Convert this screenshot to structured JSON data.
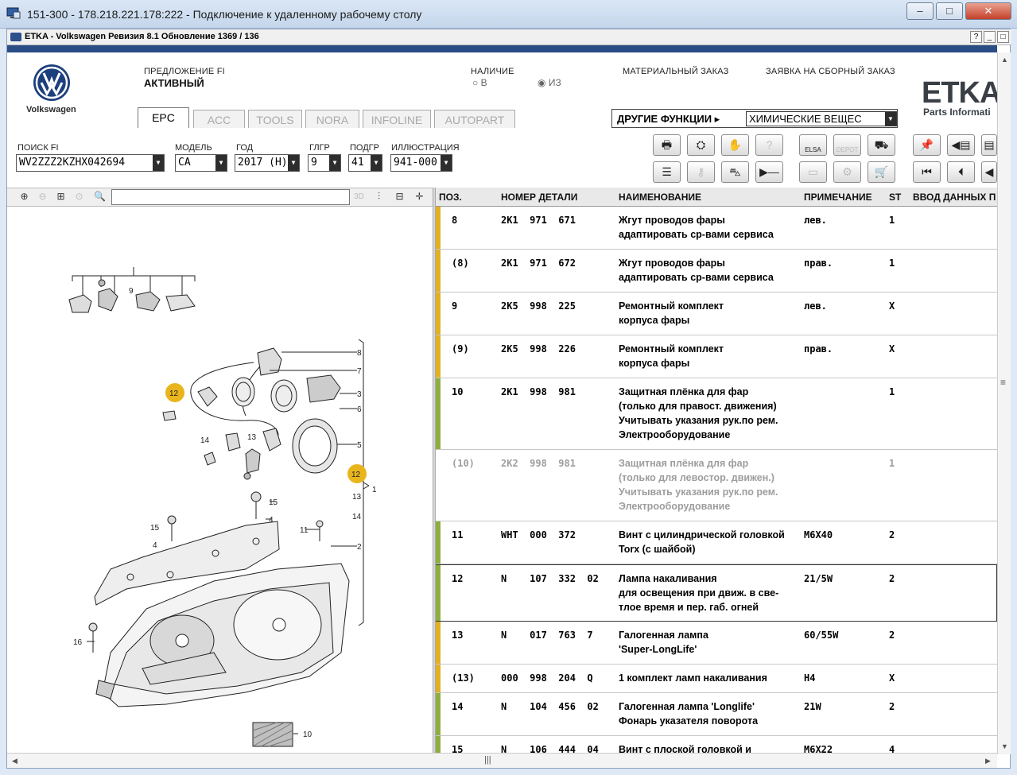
{
  "rdp": {
    "title": "151-300 - 178.218.221.178:222 - Подключение к удаленному рабочему столу"
  },
  "app": {
    "title": "ETKA - Volkswagen Ревизия 8.1 Обновление 1369 / 136",
    "help": "?",
    "min": "_",
    "max": "□"
  },
  "brand": {
    "vw_label": "Volkswagen",
    "etka": "ETKA",
    "etka_sub": "Parts Informati"
  },
  "header": {
    "proposal_label": "ПРЕДЛОЖЕНИЕ FI",
    "proposal_value": "АКТИВНЫЙ",
    "availability_label": "НАЛИЧИЕ",
    "radio_in": "В",
    "radio_from": "ИЗ",
    "material_order": "МАТЕРИАЛЬНЫЙ ЗАКАЗ",
    "assembly_order": "ЗАЯВКА НА СБОРНЫЙ ЗАКАЗ",
    "other_functions": "ДРУГИЕ ФУНКЦИИ",
    "other_functions_value": "ХИМИЧЕСКИЕ ВЕЩЕС"
  },
  "tabs": [
    "EPC",
    "ACC",
    "TOOLS",
    "NORA",
    "INFOLINE",
    "AUTOPART"
  ],
  "filters": {
    "search_label": "ПОИСК FI",
    "search_value": "WV2ZZZ2KZHX042694",
    "model_label": "МОДЕЛЬ",
    "model_value": "CA",
    "year_label": "ГОД",
    "year_value": "2017 (H)",
    "mg_label": "ГЛГР",
    "mg_value": "9",
    "sg_label": "ПОДГР",
    "sg_value": "41",
    "illus_label": "ИЛЛЮСТРАЦИЯ",
    "illus_value": "941-000"
  },
  "toolbar_labels": {
    "elsa": "ELSA",
    "depot": "DEPOT",
    "threed": "3D"
  },
  "table": {
    "headers": [
      "ПОЗ.",
      "НОМЕР ДЕТАЛИ",
      "НАИМЕНОВАНИЕ",
      "ПРИМЕЧАНИЕ",
      "ST",
      "ВВОД ДАННЫХ П"
    ],
    "rows": [
      {
        "pos": "8",
        "part": "2K1  971  671",
        "name1": "Жгут проводов фары",
        "name2": "адаптировать ср-вами сервиса",
        "name3": "",
        "name4": "",
        "note": "лев.",
        "st": "1"
      },
      {
        "pos": "(8)",
        "part": "2K1  971  672",
        "name1": "Жгут проводов фары",
        "name2": "адаптировать ср-вами сервиса",
        "name3": "",
        "name4": "",
        "note": "прав.",
        "st": "1"
      },
      {
        "pos": "9",
        "part": "2K5  998  225",
        "name1": "Ремонтный комплект",
        "name2": "корпуса фары",
        "name3": "",
        "name4": "",
        "note": "лев.",
        "st": "X"
      },
      {
        "pos": "(9)",
        "part": "2K5  998  226",
        "name1": "Ремонтный комплект",
        "name2": "корпуса фары",
        "name3": "",
        "name4": "",
        "note": "прав.",
        "st": "X"
      },
      {
        "pos": "10",
        "part": "2K1  998  981",
        "name1": "Защитная плёнка для фар",
        "name2": "(только для правост. движения)",
        "name3": "Учитывать указания рук.по рем.",
        "name4": "Электрооборудование",
        "note": "",
        "st": "1"
      },
      {
        "pos": "(10)",
        "part": "2K2  998  981",
        "name1": "Защитная плёнка для фар",
        "name2": "(только для левостор. движен.)",
        "name3": "Учитывать указания рук.по рем.",
        "name4": "Электрооборудование",
        "note": "",
        "st": "1"
      },
      {
        "pos": "11",
        "part": "WHT  000  372",
        "name1": "Винт с цилиндрической головкой",
        "name2": "Torx (с шайбой)",
        "name3": "",
        "name4": "",
        "note": "M6X40",
        "st": "2"
      },
      {
        "pos": "12",
        "part": "N    107  332  02",
        "name1": "Лампа накаливания",
        "name2": "для освещения при движ. в све-",
        "name3": "тлое время и пер. габ. огней",
        "name4": "",
        "note": "21/5W",
        "st": "2"
      },
      {
        "pos": "13",
        "part": "N    017  763  7",
        "name1": "Галогенная лампа",
        "name2": "'Super-LongLife'",
        "name3": "",
        "name4": "",
        "note": "60/55W",
        "st": "2"
      },
      {
        "pos": "(13)",
        "part": "000  998  204  Q",
        "name1": "1 комплект ламп накаливания",
        "name2": "",
        "name3": "",
        "name4": "",
        "note": "H4",
        "st": "X"
      },
      {
        "pos": "14",
        "part": "N    104  456  02",
        "name1": "Галогенная лампа 'Longlife'",
        "name2": "Фонарь указателя поворота",
        "name3": "",
        "name4": "",
        "note": "21W",
        "st": "2"
      },
      {
        "pos": "15",
        "part": "N    106  444  04",
        "name1": "Винт с плоской головкой и",
        "name2": "",
        "name3": "",
        "name4": "",
        "note": "M6X22",
        "st": "4"
      }
    ]
  },
  "illustration": {
    "callouts": [
      "9",
      "8",
      "7",
      "3",
      "6",
      "5",
      "1",
      "12",
      "13",
      "14",
      "15",
      "4",
      "11",
      "2",
      "16",
      "10"
    ]
  },
  "colors": {
    "accent_bar": "#2b4d86",
    "marker_yellow": "#e2b022",
    "marker_green": "#8fae3f",
    "callout": "#e9b51d"
  }
}
